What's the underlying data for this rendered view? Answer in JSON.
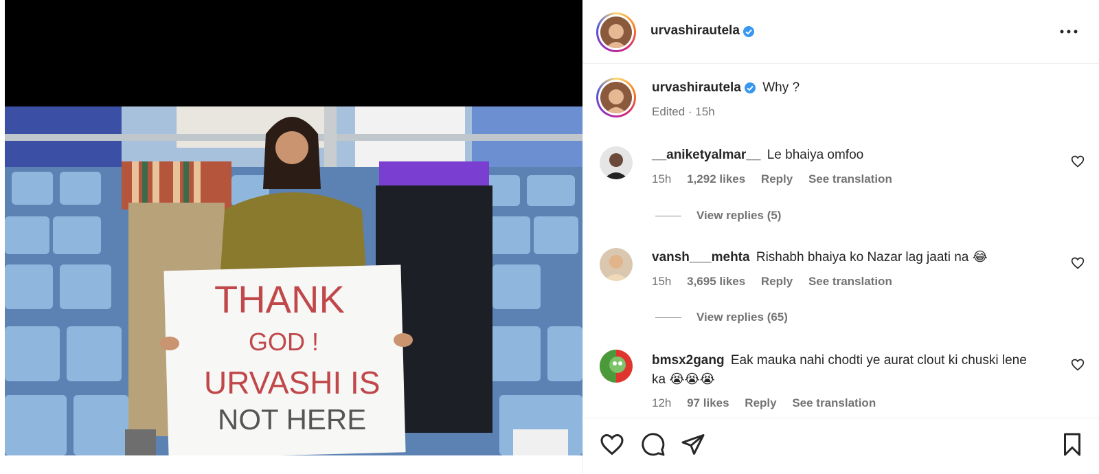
{
  "post": {
    "author": "urvashirautela",
    "caption_text": "Why ?",
    "caption_meta": "Edited · 15h"
  },
  "photo_sign": {
    "line1": "THANK",
    "line2": "GOD !",
    "line3": "URVASHI IS",
    "line4": "NOT HERE"
  },
  "comments": [
    {
      "username": "__aniketyalmar__",
      "text": "Le bhaiya omfoo",
      "time": "15h",
      "likes": "1,292 likes",
      "reply": "Reply",
      "translate": "See translation",
      "view_replies": "View replies (5)"
    },
    {
      "username": "vansh___mehta",
      "text": "Rishabh bhaiya ko Nazar lag jaati na 😂",
      "time": "15h",
      "likes": "3,695 likes",
      "reply": "Reply",
      "translate": "See translation",
      "view_replies": "View replies (65)"
    },
    {
      "username": "bmsx2gang",
      "text": "Eak mauka nahi chodti ye aurat clout ki chuski lene ka 😭😭😭",
      "time": "12h",
      "likes": "97 likes",
      "reply": "Reply",
      "translate": "See translation"
    }
  ],
  "icons": {
    "verified": "verified-badge-icon",
    "more": "more-options-icon",
    "like": "heart-icon",
    "comment": "comment-icon",
    "share": "share-icon",
    "save": "bookmark-icon"
  },
  "colors": {
    "verified_blue": "#3897f0",
    "text_primary": "#262626",
    "text_secondary": "#737373"
  }
}
